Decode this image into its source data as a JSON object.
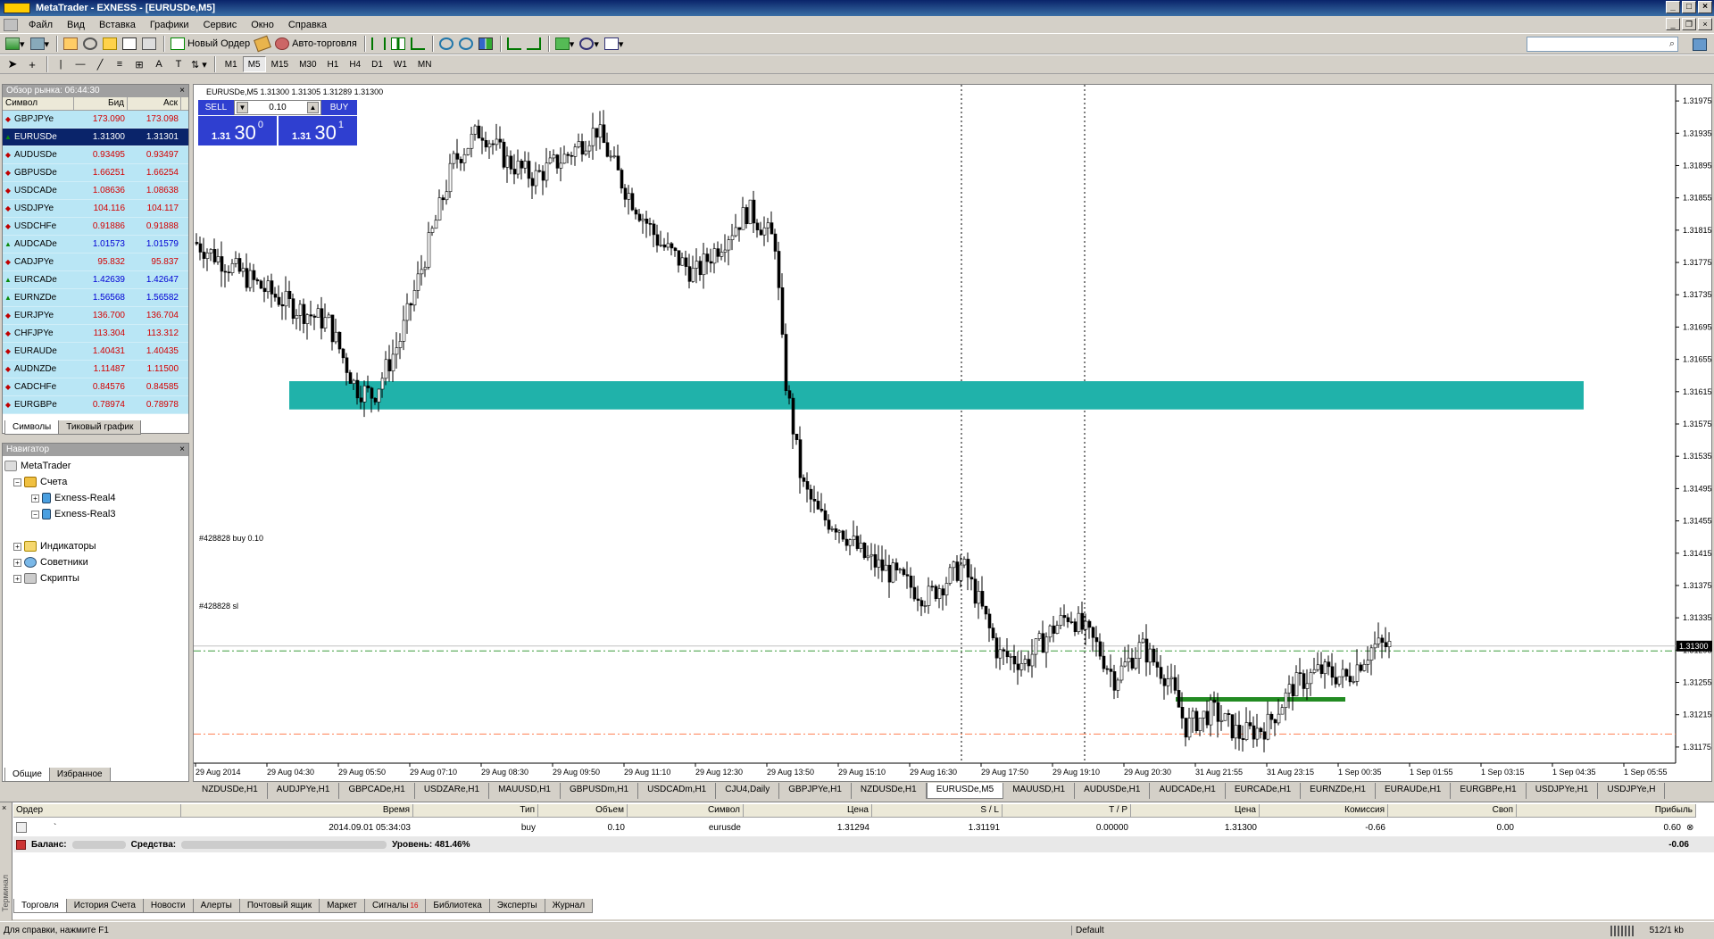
{
  "window": {
    "title": "MetaTrader - EXNESS - [EURUSDe,M5]"
  },
  "menu": [
    "Файл",
    "Вид",
    "Вставка",
    "Графики",
    "Сервис",
    "Окно",
    "Справка"
  ],
  "toolbar": {
    "new_order": "Новый Ордер",
    "auto_trading": "Авто-торговля",
    "timeframes": [
      "M1",
      "M5",
      "M15",
      "M30",
      "H1",
      "H4",
      "D1",
      "W1",
      "MN"
    ],
    "active_timeframe": "M5"
  },
  "market_watch": {
    "title": "Обзор рынка: 06:44:30",
    "columns": [
      "Символ",
      "Бид",
      "Аск"
    ],
    "rows": [
      {
        "symbol": "GBPJPYe",
        "bid": "173.090",
        "ask": "173.098",
        "dir": "down",
        "color": "red"
      },
      {
        "symbol": "EURUSDe",
        "bid": "1.31300",
        "ask": "1.31301",
        "dir": "up",
        "color": "sel"
      },
      {
        "symbol": "AUDUSDe",
        "bid": "0.93495",
        "ask": "0.93497",
        "dir": "down",
        "color": "red"
      },
      {
        "symbol": "GBPUSDe",
        "bid": "1.66251",
        "ask": "1.66254",
        "dir": "down",
        "color": "red"
      },
      {
        "symbol": "USDCADe",
        "bid": "1.08636",
        "ask": "1.08638",
        "dir": "down",
        "color": "red"
      },
      {
        "symbol": "USDJPYe",
        "bid": "104.116",
        "ask": "104.117",
        "dir": "down",
        "color": "red"
      },
      {
        "symbol": "USDCHFe",
        "bid": "0.91886",
        "ask": "0.91888",
        "dir": "down",
        "color": "red"
      },
      {
        "symbol": "AUDCADe",
        "bid": "1.01573",
        "ask": "1.01579",
        "dir": "up",
        "color": "blue"
      },
      {
        "symbol": "CADJPYe",
        "bid": "95.832",
        "ask": "95.837",
        "dir": "down",
        "color": "red"
      },
      {
        "symbol": "EURCADe",
        "bid": "1.42639",
        "ask": "1.42647",
        "dir": "up",
        "color": "blue"
      },
      {
        "symbol": "EURNZDe",
        "bid": "1.56568",
        "ask": "1.56582",
        "dir": "up",
        "color": "blue"
      },
      {
        "symbol": "EURJPYe",
        "bid": "136.700",
        "ask": "136.704",
        "dir": "down",
        "color": "red"
      },
      {
        "symbol": "CHFJPYe",
        "bid": "113.304",
        "ask": "113.312",
        "dir": "down",
        "color": "red"
      },
      {
        "symbol": "EURAUDe",
        "bid": "1.40431",
        "ask": "1.40435",
        "dir": "down",
        "color": "red"
      },
      {
        "symbol": "AUDNZDe",
        "bid": "1.11487",
        "ask": "1.11500",
        "dir": "down",
        "color": "red"
      },
      {
        "symbol": "CADCHFe",
        "bid": "0.84576",
        "ask": "0.84585",
        "dir": "down",
        "color": "red"
      },
      {
        "symbol": "EURGBPe",
        "bid": "0.78974",
        "ask": "0.78978",
        "dir": "down",
        "color": "red"
      }
    ],
    "tabs": [
      "Символы",
      "Тиковый график"
    ]
  },
  "navigator": {
    "title": "Навигатор",
    "root": "MetaTrader",
    "accounts": "Счета",
    "account_items": [
      "Exness-Real4",
      "Exness-Real3"
    ],
    "others": [
      "Индикаторы",
      "Советники",
      "Скрипты"
    ],
    "tabs": [
      "Общие",
      "Избранное"
    ]
  },
  "chart": {
    "info": "EURUSDe,M5  1.31300 1.31305 1.31289 1.31300",
    "one_click": {
      "sell": "SELL",
      "buy": "BUY",
      "lot": "0.10",
      "sell_small": "1.31",
      "sell_big": "30",
      "sell_sup": "0",
      "buy_small": "1.31",
      "buy_big": "30",
      "buy_sup": "1"
    },
    "order_buy_label": "#428828 buy 0.10",
    "order_sl_label": "#428828 sl",
    "current_price": "1.31300",
    "price_ticks": [
      "1.31975",
      "1.31935",
      "1.31895",
      "1.31855",
      "1.31815",
      "1.31775",
      "1.31735",
      "1.31695",
      "1.31655",
      "1.31615",
      "1.31575",
      "1.31535",
      "1.31495",
      "1.31455",
      "1.31415",
      "1.31375",
      "1.31335",
      "1.31295",
      "1.31255",
      "1.31215",
      "1.31175"
    ],
    "time_ticks": [
      "29 Aug 2014",
      "29 Aug 04:30",
      "29 Aug 05:50",
      "29 Aug 07:10",
      "29 Aug 08:30",
      "29 Aug 09:50",
      "29 Aug 11:10",
      "29 Aug 12:30",
      "29 Aug 13:50",
      "29 Aug 15:10",
      "29 Aug 16:30",
      "29 Aug 17:50",
      "29 Aug 19:10",
      "29 Aug 20:30",
      "31 Aug 21:55",
      "31 Aug 23:15",
      "1 Sep 00:35",
      "1 Sep 01:55",
      "1 Sep 03:15",
      "1 Sep 04:35",
      "1 Sep 05:55"
    ],
    "colors": {
      "zone": "#20b2aa",
      "support": "#228b22",
      "order_line": "#3a9a3a",
      "sl_line": "#ff7f50",
      "candle": "#000000"
    }
  },
  "chart_tabs": [
    "NZDUSDe,H1",
    "AUDJPYe,H1",
    "GBPCADe,H1",
    "USDZARe,H1",
    "MAUUSD,H1",
    "GBPUSDm,H1",
    "USDCADm,H1",
    "CJU4,Daily",
    "GBPJPYe,H1",
    "NZDUSDe,H1",
    "EURUSDe,M5",
    "MAUUSD,H1",
    "AUDUSDe,H1",
    "AUDCADe,H1",
    "EURCADe,H1",
    "EURNZDe,H1",
    "EURAUDe,H1",
    "EURGBPe,H1",
    "USDJPYe,H1",
    "USDJPYe,H"
  ],
  "active_chart_tab": "EURUSDe,M5",
  "terminal": {
    "side_label": "Терминал",
    "columns": [
      "Ордер",
      "Время",
      "Тип",
      "Объем",
      "Символ",
      "Цена",
      "S / L",
      "T / P",
      "Цена",
      "Комиссия",
      "Своп",
      "Прибыль"
    ],
    "order": {
      "id": "`",
      "time": "2014.09.01 05:34:03",
      "type": "buy",
      "volume": "0.10",
      "symbol": "eurusde",
      "price": "1.31294",
      "sl": "1.31191",
      "tp": "0.00000",
      "cur_price": "1.31300",
      "commission": "-0.66",
      "swap": "0.00",
      "profit": "0.60"
    },
    "balance_label": "Баланс:",
    "equity_label": "Средства:",
    "level_label": "Уровень: 481.46%",
    "total_profit": "-0.06",
    "tabs": [
      "Торговля",
      "История Счета",
      "Новости",
      "Алерты",
      "Почтовый ящик",
      "Маркет",
      "Сигналы",
      "Библиотека",
      "Эксперты",
      "Журнал"
    ],
    "signals_badge": "16"
  },
  "status": {
    "help": "Для справки, нажмите F1",
    "profile": "Default",
    "traffic": "512/1 kb"
  }
}
